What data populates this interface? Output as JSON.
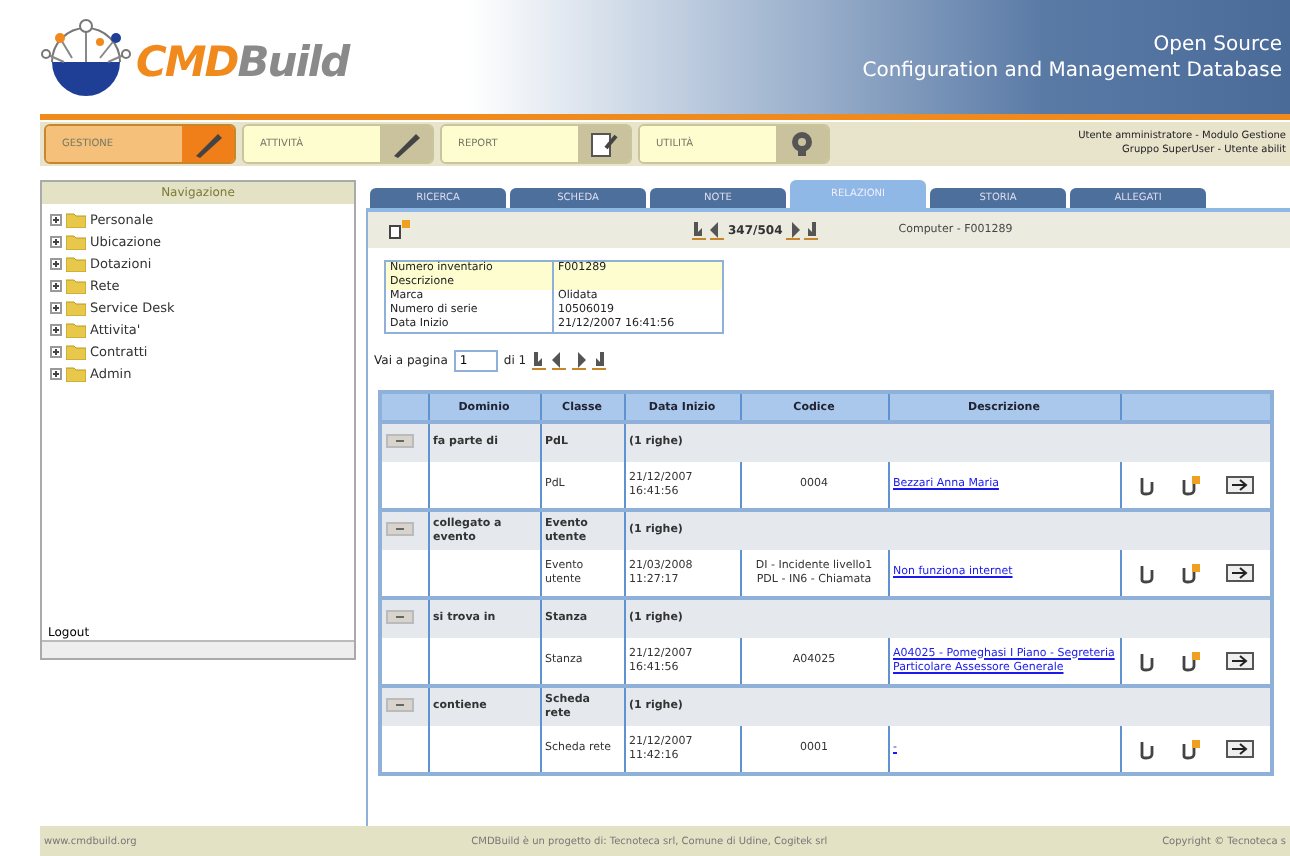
{
  "header": {
    "logo": [
      "CMD",
      "Build"
    ],
    "tagline": [
      "Open Source",
      "Configuration and Management Database"
    ]
  },
  "menu": [
    {
      "label": "GESTIONE",
      "selected": true,
      "kind": "pen"
    },
    {
      "label": "ATTIVITÀ",
      "selected": false,
      "kind": "pen"
    },
    {
      "label": "REPORT",
      "selected": false,
      "kind": "report"
    },
    {
      "label": "UTILITÀ",
      "selected": false,
      "kind": "gear"
    }
  ],
  "user_info": [
    "Utente amministratore - Modulo Gestione",
    "Gruppo SuperUser - Utente abilit"
  ],
  "navigation": {
    "title": "Navigazione",
    "items": [
      {
        "label": "Personale",
        "expanded": false
      },
      {
        "label": "Ubicazione",
        "expanded": false
      },
      {
        "label": "Dotazioni",
        "expanded": false
      },
      {
        "label": "Rete",
        "expanded": false
      },
      {
        "label": "Service Desk",
        "expanded": false
      },
      {
        "label": "Attivita'",
        "expanded": false
      },
      {
        "label": "Contratti",
        "expanded": false
      },
      {
        "label": "Admin",
        "expanded": false
      }
    ],
    "logout": "Logout"
  },
  "tabs": [
    {
      "label": "RICERCA",
      "selected": false
    },
    {
      "label": "SCHEDA",
      "selected": false
    },
    {
      "label": "NOTE",
      "selected": false
    },
    {
      "label": "RELAZIONI",
      "selected": true
    },
    {
      "label": "STORIA",
      "selected": false
    },
    {
      "label": "ALLEGATI",
      "selected": false
    }
  ],
  "record_nav": {
    "position": "347/504",
    "title": "Computer - F001289"
  },
  "card": [
    {
      "label": "Numero inventario",
      "value": "F001289",
      "highlight": true
    },
    {
      "label": "Descrizione",
      "highlight": true
    },
    {
      "label": "Marca",
      "value": "Olidata",
      "highlight": false
    },
    {
      "label": "Numero di serie",
      "value": "10506019",
      "highlight": false
    },
    {
      "label": "Data Inizio",
      "value": "21/12/2007 16:41:56",
      "highlight": false
    }
  ],
  "pager": {
    "before": "Vai a pagina",
    "page": "1",
    "after": "di 1"
  },
  "table": {
    "columns": [
      "Dominio",
      "Classe",
      "Data Inizio",
      "Codice",
      "Descrizione"
    ],
    "groups": [
      {
        "domain": "fa parte di",
        "class": "PdL",
        "count": "(1 righe)",
        "expanded": true,
        "rows": [
          {
            "class": "PdL",
            "date": "21/12/2007 16:41:56",
            "code": "0004",
            "description": "Bezzari Anna Maria"
          }
        ]
      },
      {
        "domain": "collegato a evento",
        "class": "Evento utente",
        "count": "(1 righe)",
        "expanded": true,
        "rows": [
          {
            "class": "Evento utente",
            "date": "21/03/2008 11:27:17",
            "code": "DI - Incidente livello1 PDL - IN6 - Chiamata",
            "description": "Non funziona internet"
          }
        ]
      },
      {
        "domain": "si trova in",
        "class": "Stanza",
        "count": "(1 righe)",
        "expanded": true,
        "rows": [
          {
            "class": "Stanza",
            "date": "21/12/2007 16:41:56",
            "code": "A04025",
            "description": "A04025 - Pomeghasi I Piano - Segreteria Particolare Assessore Generale"
          }
        ]
      },
      {
        "domain": "contiene",
        "class": "Scheda rete",
        "count": "(1 righe)",
        "expanded": true,
        "rows": [
          {
            "class": "Scheda rete",
            "date": "21/12/2007 11:42:16",
            "code": "0001",
            "description": "-"
          }
        ]
      }
    ]
  },
  "footer": [
    "www.cmdbuild.org",
    "CMDBuild è un progetto di: Tecnoteca srl, Comune di Udine, Cogitek srl",
    "Copyright © Tecnoteca s"
  ]
}
